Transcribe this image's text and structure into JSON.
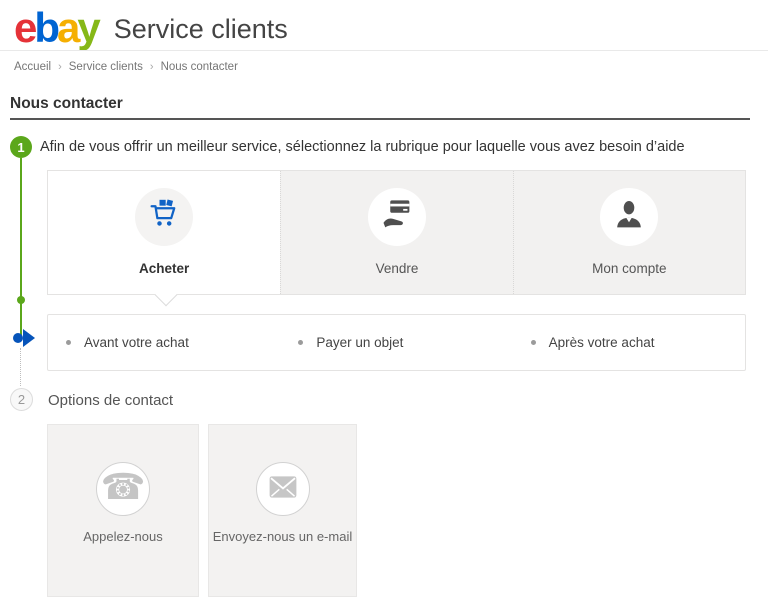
{
  "header": {
    "logo_letters": [
      "e",
      "b",
      "a",
      "y"
    ],
    "title": "Service clients"
  },
  "breadcrumb": {
    "separator": "›",
    "items": [
      "Accueil",
      "Service clients",
      "Nous contacter"
    ]
  },
  "page": {
    "title": "Nous contacter"
  },
  "steps": {
    "step1": {
      "number": "1",
      "text": "Afin de vous offrir un meilleur service, sélectionnez la rubrique pour laquelle vous avez besoin d’aide"
    },
    "step2": {
      "number": "2",
      "text": "Options de contact"
    }
  },
  "categories": {
    "tabs": [
      {
        "label": "Acheter",
        "icon": "shopping-cart-icon",
        "selected": true
      },
      {
        "label": "Vendre",
        "icon": "card-in-hand-icon",
        "selected": false
      },
      {
        "label": "Mon compte",
        "icon": "person-icon",
        "selected": false
      }
    ],
    "suboptions": [
      {
        "label": "Avant votre achat"
      },
      {
        "label": "Payer un objet"
      },
      {
        "label": "Après votre achat"
      }
    ]
  },
  "contact_options": [
    {
      "label": "Appelez-nous",
      "icon": "phone-icon"
    },
    {
      "label": "Envoyez-nous un e-mail",
      "icon": "envelope-icon"
    }
  ],
  "colors": {
    "logo_e_red": "#e53238",
    "logo_b_blue": "#0064d2",
    "logo_a_yellow": "#f5af02",
    "logo_y_green": "#86b817",
    "step_active_green": "#5ba71b",
    "marker_blue": "#0654ba",
    "cart_icon_blue": "#1163c6",
    "dark_icon_gray": "#4f4f4f",
    "light_icon_gray": "#c6c6c6",
    "tab_inactive_bg": "#f2f1f0",
    "card_bg": "#f3f2f1",
    "title_rule": "#555555"
  }
}
